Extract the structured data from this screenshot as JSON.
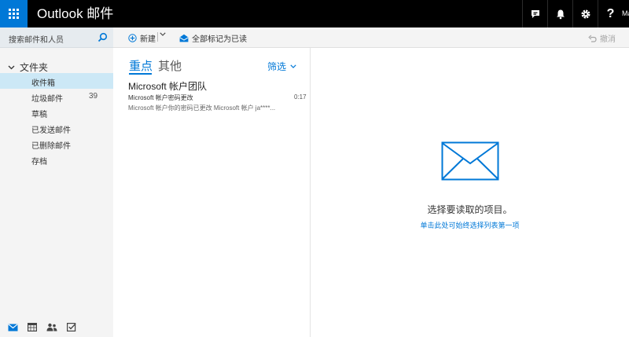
{
  "header": {
    "app_title": "Outlook 邮件",
    "user_name": "Ma"
  },
  "search": {
    "placeholder": "搜索邮件和人员"
  },
  "folders": {
    "header": "文件夹",
    "items": [
      {
        "label": "收件箱",
        "count": "",
        "selected": true
      },
      {
        "label": "垃圾邮件",
        "count": "39",
        "selected": false
      },
      {
        "label": "草稿",
        "count": "",
        "selected": false
      },
      {
        "label": "已发送邮件",
        "count": "",
        "selected": false
      },
      {
        "label": "已删除邮件",
        "count": "",
        "selected": false
      },
      {
        "label": "存档",
        "count": "",
        "selected": false
      }
    ]
  },
  "toolbar": {
    "new_label": "新建",
    "mark_all_read_label": "全部标记为已读",
    "undo_label": "撤消"
  },
  "list": {
    "tab_focused": "重点",
    "tab_other": "其他",
    "filter_label": "筛选",
    "messages": [
      {
        "sender": "Microsoft 帐户团队",
        "subject": "Microsoft 帐户密码更改",
        "time": "0:17",
        "preview": "Microsoft 帐户你的密码已更改 Microsoft 帐户 ja****..."
      }
    ]
  },
  "reading_pane": {
    "empty_title": "选择要读取的项目。",
    "empty_link": "单击此处可始终选择列表第一项"
  },
  "colors": {
    "accent": "#0078d7",
    "topbar": "#000000",
    "nav_bg": "#f4f4f4",
    "selected_bg": "#cce8f6"
  }
}
